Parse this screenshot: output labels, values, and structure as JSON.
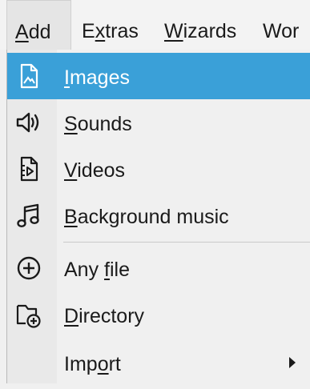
{
  "menubar": {
    "items": [
      {
        "pre": "",
        "ul": "A",
        "post": "dd"
      },
      {
        "pre": "E",
        "ul": "x",
        "post": "tras"
      },
      {
        "pre": "",
        "ul": "W",
        "post": "izards"
      },
      {
        "pre": "Wor",
        "ul": "",
        "post": ""
      }
    ]
  },
  "menu": {
    "items": [
      {
        "pre": "",
        "ul": "I",
        "post": "mages",
        "icon": "image-file-icon"
      },
      {
        "pre": "",
        "ul": "S",
        "post": "ounds",
        "icon": "speaker-icon"
      },
      {
        "pre": "",
        "ul": "V",
        "post": "ideos",
        "icon": "video-file-icon"
      },
      {
        "pre": "",
        "ul": "B",
        "post": "ackground music",
        "icon": "music-note-icon"
      },
      {
        "pre": "Any ",
        "ul": "f",
        "post": "ile",
        "icon": "add-circle-icon"
      },
      {
        "pre": "",
        "ul": "D",
        "post": "irectory",
        "icon": "add-folder-icon"
      },
      {
        "pre": "Imp",
        "ul": "o",
        "post": "rt",
        "icon": ""
      }
    ]
  },
  "colors": {
    "highlight": "#3aa0d8",
    "icon_column": "#e9e9e9",
    "background": "#f0f0f0"
  }
}
